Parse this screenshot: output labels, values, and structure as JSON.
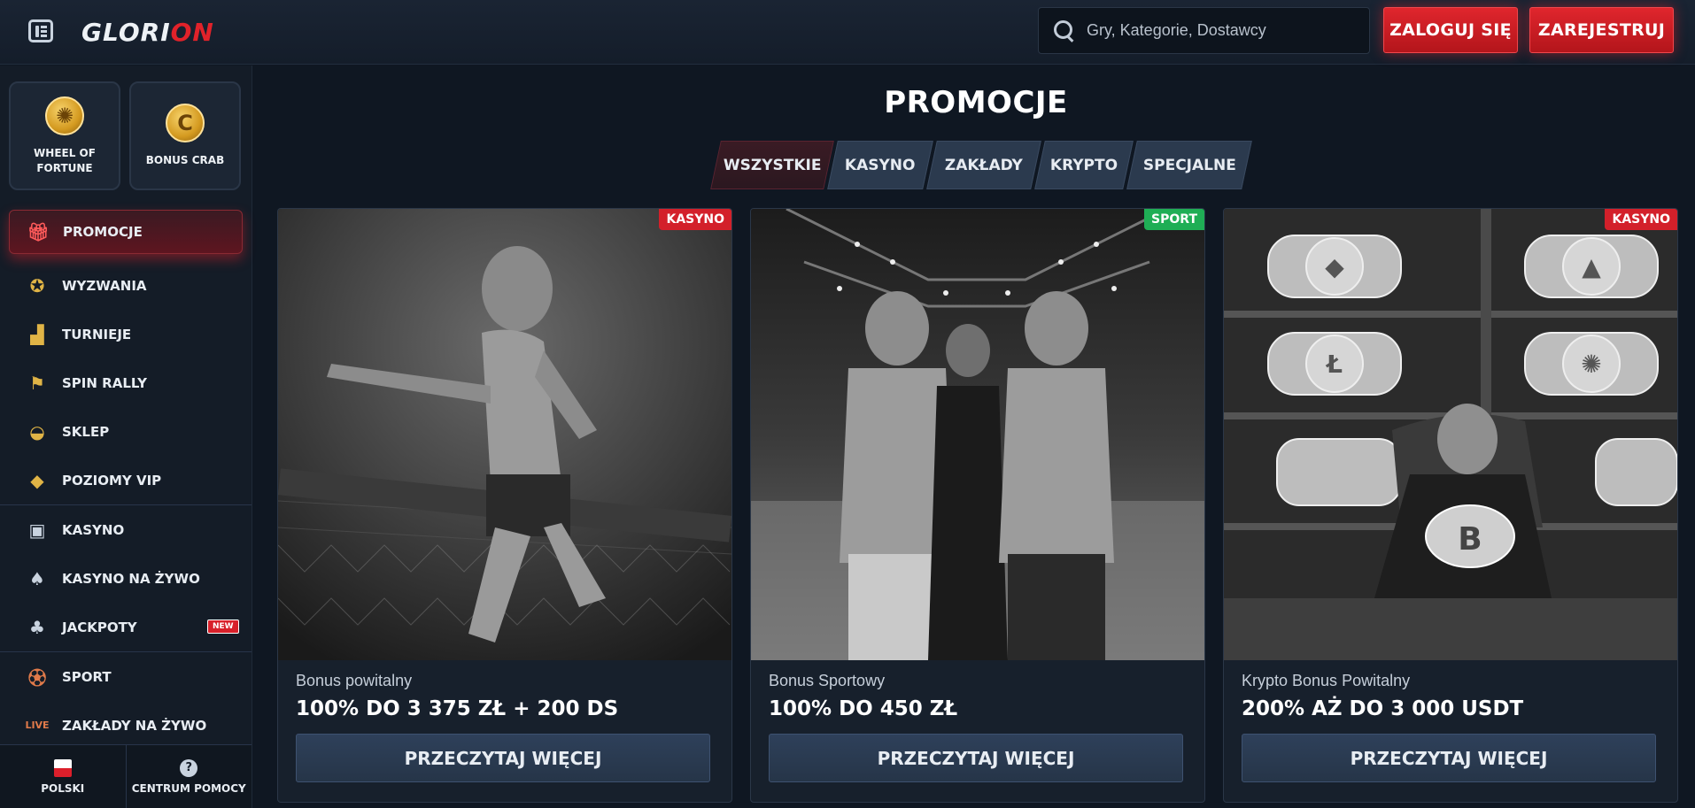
{
  "header": {
    "logo_main": "GLORI",
    "logo_accent": "ON",
    "search_placeholder": "Gry, Kategorie, Dostawcy",
    "login_label": "ZALOGUJ SIĘ",
    "register_label": "ZAREJESTRUJ"
  },
  "sidebar": {
    "tiles": [
      {
        "label": "WHEEL OF FORTUNE",
        "icon": "wheel-icon"
      },
      {
        "label": "BONUS CRAB",
        "icon": "crab-coin-icon"
      }
    ],
    "items": [
      {
        "label": "PROMOCJE",
        "icon": "gift-icon",
        "active": true
      },
      {
        "label": "WYZWANIA",
        "icon": "medal-icon"
      },
      {
        "label": "TURNIEJE",
        "icon": "podium-icon"
      },
      {
        "label": "SPIN RALLY",
        "icon": "checkered-flag-icon"
      },
      {
        "label": "SKLEP",
        "icon": "basket-icon"
      },
      {
        "label": "POZIOMY VIP",
        "icon": "diamond-icon"
      },
      {
        "label": "KASYNO",
        "icon": "slot-machine-icon"
      },
      {
        "label": "KASYNO NA ŻYWO",
        "icon": "cards-icon"
      },
      {
        "label": "JACKPOTY",
        "icon": "clover-icon",
        "badge": "NEW"
      },
      {
        "label": "SPORT",
        "icon": "ball-icon"
      },
      {
        "label": "ZAKŁADY NA ŻYWO",
        "icon": "live-icon"
      }
    ],
    "footer": {
      "language": "POLSKI",
      "help": "CENTRUM POMOCY"
    }
  },
  "main": {
    "title": "PROMOCJE",
    "tabs": [
      {
        "label": "WSZYSTKIE",
        "active": true
      },
      {
        "label": "KASYNO"
      },
      {
        "label": "ZAKŁADY"
      },
      {
        "label": "KRYPTO"
      },
      {
        "label": "SPECJALNE"
      }
    ],
    "cards": [
      {
        "tag": "KASYNO",
        "subtitle": "Bonus powitalny",
        "headline": "100% DO 3 375 ZŁ + 200 DS",
        "cta": "PRZECZYTAJ WIĘCEJ"
      },
      {
        "tag": "SPORT",
        "subtitle": "Bonus Sportowy",
        "headline": "100% DO 450 ZŁ",
        "cta": "PRZECZYTAJ WIĘCEJ"
      },
      {
        "tag": "KASYNO",
        "subtitle": "Krypto Bonus Powitalny",
        "headline": "200% AŻ DO 3 000 USDT",
        "cta": "PRZECZYTAJ WIĘCEJ"
      }
    ]
  },
  "colors": {
    "accent_red": "#e1222a",
    "sport_green": "#1fae55",
    "background": "#0f1722",
    "panel": "#141c27"
  }
}
